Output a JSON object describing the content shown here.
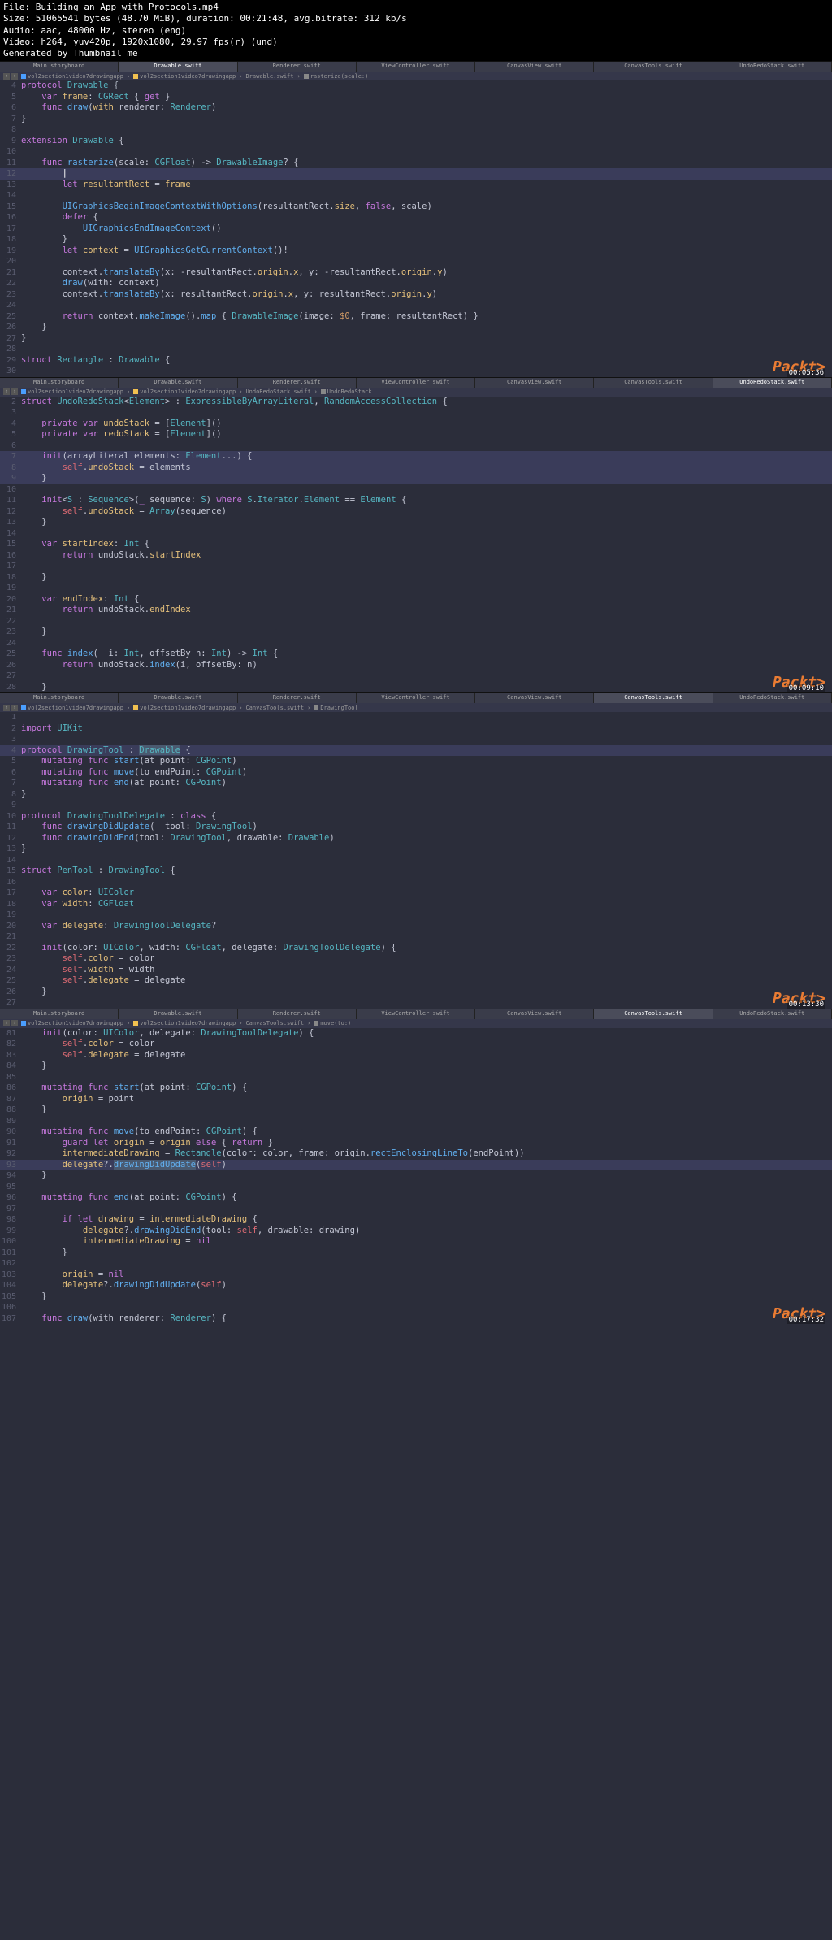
{
  "header": {
    "file": "File: Building an App with Protocols.mp4",
    "size": "Size: 51065541 bytes (48.70 MiB), duration: 00:21:48, avg.bitrate: 312 kb/s",
    "audio": "Audio: aac, 48000 Hz, stereo (eng)",
    "video": "Video: h264, yuv420p, 1920x1080, 29.97 fps(r) (und)",
    "gen": "Generated by Thumbnail me"
  },
  "tabs": {
    "t1": "Main.storyboard",
    "t2": "Drawable.swift",
    "t3": "Renderer.swift",
    "t4": "ViewController.swift",
    "t5": "CanvasView.swift",
    "t6": "CanvasTools.swift",
    "t7": "UndoRedoStack.swift"
  },
  "bc": {
    "app1": "vol2section1video7drawingapp",
    "app2": "vol2section1video7drawingapp",
    "draw": "Drawable.swift",
    "rast": "rasterize(scale:)",
    "undo": "UndoRedoStack.swift",
    "undostruct": "UndoRedoStack",
    "canvas": "CanvasTools.swift",
    "drawtool": "DrawingTool",
    "moveto": "move(to:)"
  },
  "watermark": "Packt>",
  "timestamps": {
    "p1": "00:05:36",
    "p2": "00:09:10",
    "p3": "00:13:30",
    "p4": "00:17:32"
  },
  "code1": {
    "l4": {
      "n": "4",
      "c": "protocol Drawable {"
    },
    "l5": {
      "n": "5",
      "c": "    var frame: CGRect { get }"
    },
    "l6": {
      "n": "6",
      "c": "    func draw(with renderer: Renderer)"
    },
    "l7": {
      "n": "7",
      "c": "}"
    },
    "l8": {
      "n": "8",
      "c": ""
    },
    "l9": {
      "n": "9",
      "c": "extension Drawable {"
    },
    "l10": {
      "n": "10",
      "c": ""
    },
    "l11": {
      "n": "11",
      "c": "    func rasterize(scale: CGFloat) -> DrawableImage? {"
    },
    "l12": {
      "n": "12",
      "c": "        |"
    },
    "l13": {
      "n": "13",
      "c": "        let resultantRect = frame"
    },
    "l14": {
      "n": "14",
      "c": ""
    },
    "l15": {
      "n": "15",
      "c": "        UIGraphicsBeginImageContextWithOptions(resultantRect.size, false, scale)"
    },
    "l16": {
      "n": "16",
      "c": "        defer {"
    },
    "l17": {
      "n": "17",
      "c": "            UIGraphicsEndImageContext()"
    },
    "l18": {
      "n": "18",
      "c": "        }"
    },
    "l19": {
      "n": "19",
      "c": "        let context = UIGraphicsGetCurrentContext()!"
    },
    "l20": {
      "n": "20",
      "c": ""
    },
    "l21": {
      "n": "21",
      "c": "        context.translateBy(x: -resultantRect.origin.x, y: -resultantRect.origin.y)"
    },
    "l22": {
      "n": "22",
      "c": "        draw(with: context)"
    },
    "l23": {
      "n": "23",
      "c": "        context.translateBy(x: resultantRect.origin.x, y: resultantRect.origin.y)"
    },
    "l24": {
      "n": "24",
      "c": ""
    },
    "l25": {
      "n": "25",
      "c": "        return context.makeImage().map { DrawableImage(image: $0, frame: resultantRect) }"
    },
    "l26": {
      "n": "26",
      "c": "    }"
    },
    "l27": {
      "n": "27",
      "c": "}"
    },
    "l28": {
      "n": "28",
      "c": ""
    },
    "l29": {
      "n": "29",
      "c": "struct Rectangle : Drawable {"
    },
    "l30": {
      "n": "30",
      "c": ""
    }
  },
  "code2": {
    "l2": {
      "n": "2",
      "c": "struct UndoRedoStack<Element> : ExpressibleByArrayLiteral, RandomAccessCollection {"
    },
    "l3": {
      "n": "3",
      "c": ""
    },
    "l4": {
      "n": "4",
      "c": "    private var undoStack = [Element]()"
    },
    "l5": {
      "n": "5",
      "c": "    private var redoStack = [Element]()"
    },
    "l6": {
      "n": "6",
      "c": ""
    },
    "l7": {
      "n": "7",
      "c": "    init(arrayLiteral elements: Element...) {"
    },
    "l8": {
      "n": "8",
      "c": "        self.undoStack = elements"
    },
    "l9": {
      "n": "9",
      "c": "    }"
    },
    "l10": {
      "n": "10",
      "c": ""
    },
    "l11": {
      "n": "11",
      "c": "    init<S : Sequence>(_ sequence: S) where S.Iterator.Element == Element {"
    },
    "l12": {
      "n": "12",
      "c": "        self.undoStack = Array(sequence)"
    },
    "l13": {
      "n": "13",
      "c": "    }"
    },
    "l14": {
      "n": "14",
      "c": ""
    },
    "l15": {
      "n": "15",
      "c": "    var startIndex: Int {"
    },
    "l16": {
      "n": "16",
      "c": "        return undoStack.startIndex"
    },
    "l17": {
      "n": "17",
      "c": ""
    },
    "l18": {
      "n": "18",
      "c": "    }"
    },
    "l19": {
      "n": "19",
      "c": ""
    },
    "l20": {
      "n": "20",
      "c": "    var endIndex: Int {"
    },
    "l21": {
      "n": "21",
      "c": "        return undoStack.endIndex"
    },
    "l22": {
      "n": "22",
      "c": ""
    },
    "l23": {
      "n": "23",
      "c": "    }"
    },
    "l24": {
      "n": "24",
      "c": ""
    },
    "l25": {
      "n": "25",
      "c": "    func index(_ i: Int, offsetBy n: Int) -> Int {"
    },
    "l26": {
      "n": "26",
      "c": "        return undoStack.index(i, offsetBy: n)"
    },
    "l27": {
      "n": "27",
      "c": ""
    },
    "l28": {
      "n": "28",
      "c": "    }"
    }
  },
  "code3": {
    "l1": {
      "n": "1",
      "c": ""
    },
    "l2": {
      "n": "2",
      "c": "import UIKit"
    },
    "l3": {
      "n": "3",
      "c": ""
    },
    "l4": {
      "n": "4",
      "c": "protocol DrawingTool : Drawable {"
    },
    "l5": {
      "n": "5",
      "c": "    mutating func start(at point: CGPoint)"
    },
    "l6": {
      "n": "6",
      "c": "    mutating func move(to endPoint: CGPoint)"
    },
    "l7": {
      "n": "7",
      "c": "    mutating func end(at point: CGPoint)"
    },
    "l8": {
      "n": "8",
      "c": "}"
    },
    "l9": {
      "n": "9",
      "c": ""
    },
    "l10": {
      "n": "10",
      "c": "protocol DrawingToolDelegate : class {"
    },
    "l11": {
      "n": "11",
      "c": "    func drawingDidUpdate(_ tool: DrawingTool)"
    },
    "l12": {
      "n": "12",
      "c": "    func drawingDidEnd(tool: DrawingTool, drawable: Drawable)"
    },
    "l13": {
      "n": "13",
      "c": "}"
    },
    "l14": {
      "n": "14",
      "c": ""
    },
    "l15": {
      "n": "15",
      "c": "struct PenTool : DrawingTool {"
    },
    "l16": {
      "n": "16",
      "c": ""
    },
    "l17": {
      "n": "17",
      "c": "    var color: UIColor"
    },
    "l18": {
      "n": "18",
      "c": "    var width: CGFloat"
    },
    "l19": {
      "n": "19",
      "c": ""
    },
    "l20": {
      "n": "20",
      "c": "    var delegate: DrawingToolDelegate?"
    },
    "l21": {
      "n": "21",
      "c": ""
    },
    "l22": {
      "n": "22",
      "c": "    init(color: UIColor, width: CGFloat, delegate: DrawingToolDelegate) {"
    },
    "l23": {
      "n": "23",
      "c": "        self.color = color"
    },
    "l24": {
      "n": "24",
      "c": "        self.width = width"
    },
    "l25": {
      "n": "25",
      "c": "        self.delegate = delegate"
    },
    "l26": {
      "n": "26",
      "c": "    }"
    },
    "l27": {
      "n": "27",
      "c": ""
    }
  },
  "code4": {
    "l81": {
      "n": "81",
      "c": "    init(color: UIColor, delegate: DrawingToolDelegate) {"
    },
    "l82": {
      "n": "82",
      "c": "        self.color = color"
    },
    "l83": {
      "n": "83",
      "c": "        self.delegate = delegate"
    },
    "l84": {
      "n": "84",
      "c": "    }"
    },
    "l85": {
      "n": "85",
      "c": ""
    },
    "l86": {
      "n": "86",
      "c": "    mutating func start(at point: CGPoint) {"
    },
    "l87": {
      "n": "87",
      "c": "        origin = point"
    },
    "l88": {
      "n": "88",
      "c": "    }"
    },
    "l89": {
      "n": "89",
      "c": ""
    },
    "l90": {
      "n": "90",
      "c": "    mutating func move(to endPoint: CGPoint) {"
    },
    "l91": {
      "n": "91",
      "c": "        guard let origin = origin else { return }"
    },
    "l92": {
      "n": "92",
      "c": "        intermediateDrawing = Rectangle(color: color, frame: origin.rectEnclosingLineTo(endPoint))"
    },
    "l93": {
      "n": "93",
      "c": "        delegate?.drawingDidUpdate(self)"
    },
    "l94": {
      "n": "94",
      "c": "    }"
    },
    "l95": {
      "n": "95",
      "c": ""
    },
    "l96": {
      "n": "96",
      "c": "    mutating func end(at point: CGPoint) {"
    },
    "l97": {
      "n": "97",
      "c": ""
    },
    "l98": {
      "n": "98",
      "c": "        if let drawing = intermediateDrawing {"
    },
    "l99": {
      "n": "99",
      "c": "            delegate?.drawingDidEnd(tool: self, drawable: drawing)"
    },
    "l100": {
      "n": "100",
      "c": "            intermediateDrawing = nil"
    },
    "l101": {
      "n": "101",
      "c": "        }"
    },
    "l102": {
      "n": "102",
      "c": ""
    },
    "l103": {
      "n": "103",
      "c": "        origin = nil"
    },
    "l104": {
      "n": "104",
      "c": "        delegate?.drawingDidUpdate(self)"
    },
    "l105": {
      "n": "105",
      "c": "    }"
    },
    "l106": {
      "n": "106",
      "c": ""
    },
    "l107": {
      "n": "107",
      "c": "    func draw(with renderer: Renderer) {"
    }
  }
}
